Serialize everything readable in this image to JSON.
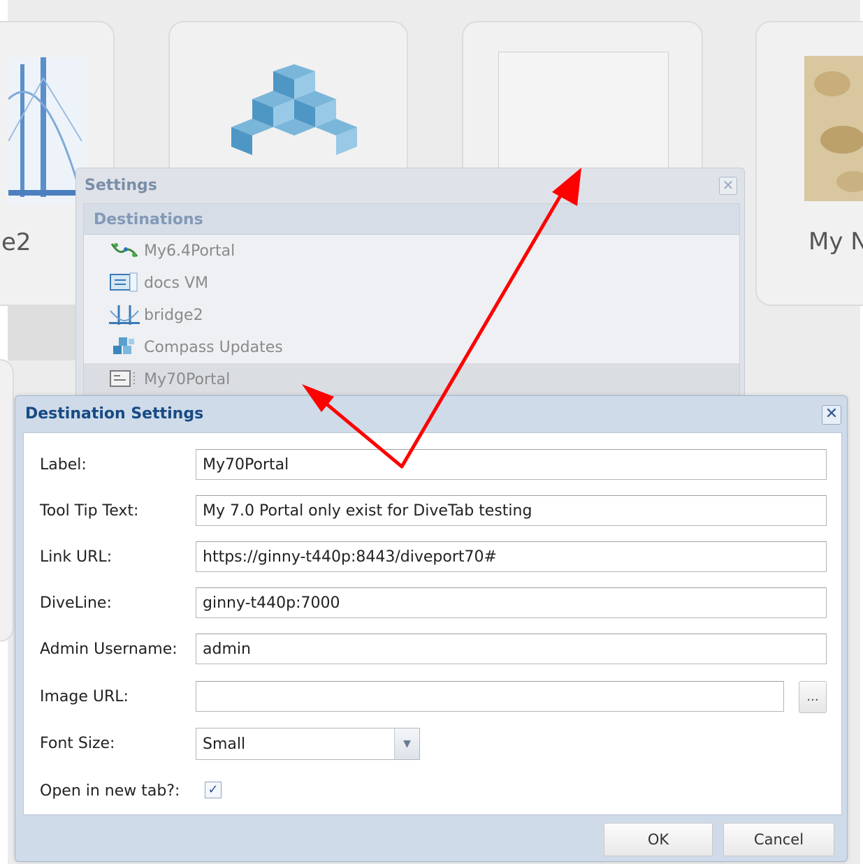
{
  "background": {
    "tiles": [
      {
        "label": "e2"
      },
      {
        "label": ""
      },
      {
        "label": ""
      },
      {
        "label": "My N"
      }
    ]
  },
  "settings": {
    "title": "Settings",
    "destinations_header": "Destinations",
    "destinations": [
      {
        "label": "My6.4Portal",
        "icon": "portal-icon"
      },
      {
        "label": "docs VM",
        "icon": "vm-icon"
      },
      {
        "label": "bridge2",
        "icon": "bridge-icon"
      },
      {
        "label": "Compass Updates",
        "icon": "cubes-icon"
      },
      {
        "label": "My70Portal",
        "icon": "form-icon",
        "selected": true
      }
    ]
  },
  "dialog": {
    "title": "Destination Settings",
    "fields": {
      "label": {
        "label": "Label:",
        "value": "My70Portal"
      },
      "tooltip": {
        "label": "Tool Tip Text:",
        "value": "My 7.0 Portal only exist for DiveTab testing"
      },
      "link_url": {
        "label": "Link URL:",
        "value": "https://ginny-t440p:8443/diveport70#"
      },
      "diveline": {
        "label": "DiveLine:",
        "value": "ginny-t440p:7000"
      },
      "admin_username": {
        "label": "Admin Username:",
        "value": "admin"
      },
      "image_url": {
        "label": "Image URL:",
        "value": "",
        "browse_label": "..."
      },
      "font_size": {
        "label": "Font Size:",
        "value": "Small"
      },
      "open_new_tab": {
        "label": "Open in new tab?:",
        "checked": true
      }
    },
    "ok_label": "OK",
    "cancel_label": "Cancel"
  },
  "annotation_color": "#ff0000"
}
